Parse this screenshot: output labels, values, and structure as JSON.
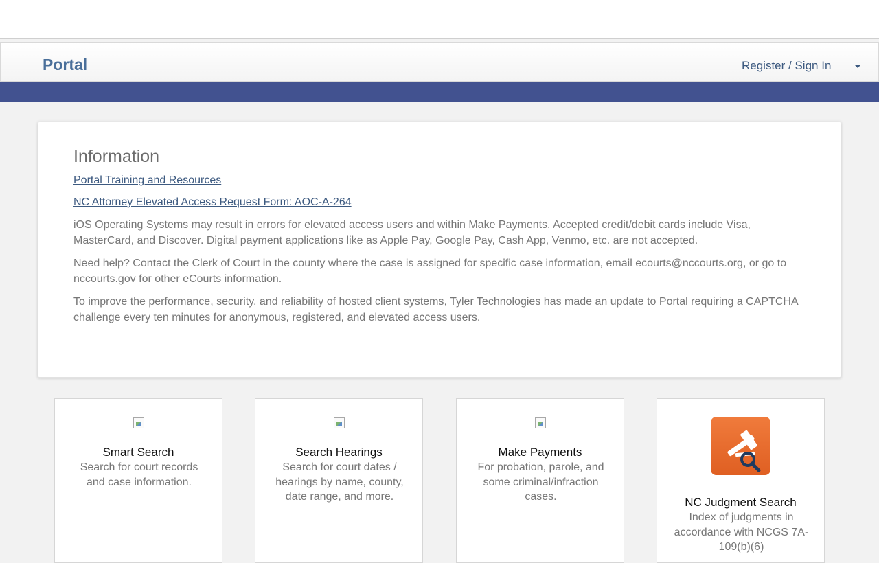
{
  "header": {
    "brand": "Portal",
    "signin_label": "Register / Sign In"
  },
  "info": {
    "title": "Information",
    "links": [
      "Portal Training and Resources",
      "NC Attorney Elevated Access Request Form: AOC-A-264"
    ],
    "paragraphs": [
      "iOS Operating Systems may result in errors for elevated access users and within Make Payments. Accepted credit/debit cards include Visa, MasterCard, and Discover. Digital payment applications like as Apple Pay, Google Pay, Cash App, Venmo, etc. are not accepted.",
      "Need help? Contact the Clerk of Court in the county where the case is assigned for specific case information, email ecourts@nccourts.org, or go to nccourts.gov for other eCourts information.",
      "To improve the performance, security, and reliability of hosted client systems, Tyler Technologies has made an update to Portal requiring a CAPTCHA challenge every ten minutes for anonymous, registered, and elevated access users."
    ]
  },
  "tiles": [
    {
      "title": "Smart Search",
      "desc": "Search for court records and case information.",
      "icon": "broken-image-icon"
    },
    {
      "title": "Search Hearings",
      "desc": "Search for court dates / hearings by name, county, date range, and more.",
      "icon": "broken-image-icon"
    },
    {
      "title": "Make Payments",
      "desc": "For probation, parole, and some criminal/infraction cases.",
      "icon": "broken-image-icon"
    },
    {
      "title": "NC Judgment Search",
      "desc": "Index of judgments in accordance with NCGS 7A-109(b)(6)",
      "icon": "gavel-search-icon"
    }
  ],
  "colors": {
    "brand": "#4a6f9a",
    "bar": "#425290",
    "judgment_icon": "#e8692c"
  }
}
